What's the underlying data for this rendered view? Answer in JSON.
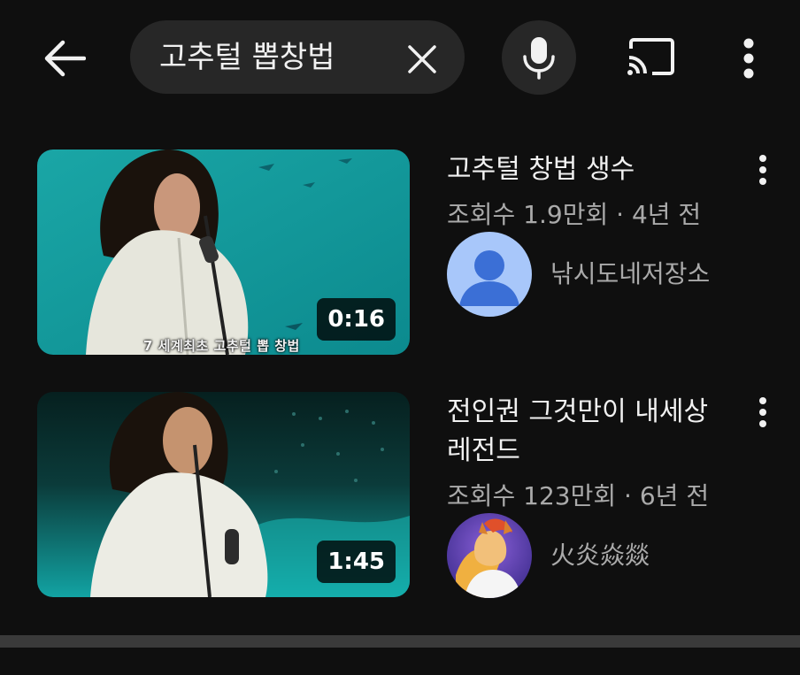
{
  "search": {
    "query": "고추털 뽑창법"
  },
  "results": [
    {
      "title": "고추털 창법 생수",
      "views": "조회수 1.9만회",
      "age": "4년 전",
      "channel": "낚시도네저장소",
      "duration": "0:16",
      "burned_caption": "7 세계최초 고추털 뽑 창법"
    },
    {
      "title": "전인권 그것만이 내세상 레전드",
      "views": "조회수 123만회",
      "age": "6년 전",
      "channel": "火炎焱燚",
      "duration": "1:45"
    }
  ],
  "meta_separator": " · ",
  "colors": {
    "background": "#0f0f0f",
    "surface": "#272727",
    "text_primary": "#f1f1f1",
    "text_secondary": "#aaaaaa",
    "default_avatar": "#a8c7fa"
  },
  "icons": [
    "back-arrow-icon",
    "clear-icon",
    "mic-icon",
    "cast-icon",
    "more-vert-icon",
    "default-avatar-icon"
  ]
}
